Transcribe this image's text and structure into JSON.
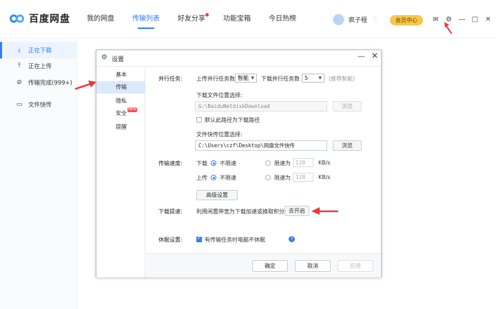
{
  "app": {
    "logo_text": "百度网盘",
    "nav": [
      "我的网盘",
      "传输列表",
      "好友分享",
      "功能宝箱",
      "今日热榜"
    ],
    "active_nav": "传输列表",
    "user": {
      "name": "疯子程"
    },
    "vip_label": "会员中心"
  },
  "sidebar": {
    "items": [
      {
        "label": "正在下载",
        "icon": "download-icon"
      },
      {
        "label": "正在上传",
        "icon": "upload-icon"
      },
      {
        "label": "传输完成(999+)",
        "icon": "check-circle-icon"
      },
      {
        "label": "文件快传",
        "icon": "monitor-icon"
      }
    ],
    "active": "正在下载"
  },
  "dialog": {
    "title": "设置",
    "nav": [
      {
        "label": "基本"
      },
      {
        "label": "传输"
      },
      {
        "label": "隐私"
      },
      {
        "label": "安全",
        "badge": "NEW"
      },
      {
        "label": "提醒"
      }
    ],
    "active_nav": "传输",
    "parallel": {
      "section": "并行任务:",
      "upload_label": "上传并行任务数",
      "upload_value": "智能",
      "download_label": "下载并行任务数",
      "download_value": "5",
      "hint": "(推荐智能)"
    },
    "download_dir": {
      "label": "下载文件位置选择:",
      "path": "G:\\BaiduNetdiskDownload",
      "browse": "浏览",
      "default_checkbox": "默认此路径为下载路径",
      "default_checked": false
    },
    "quick_transfer_dir": {
      "label": "文件快传位置选择:",
      "path": "C:\\Users\\czf\\Desktop\\网盘文件快传",
      "browse": "浏览"
    },
    "speed": {
      "section": "传输速度:",
      "download_label": "下载",
      "upload_label": "上传",
      "unlimited": "不限速",
      "limit_to": "限速为",
      "download_limit": "128",
      "upload_limit": "128",
      "unit": "KB/s",
      "advanced": "高级设置"
    },
    "boost": {
      "section": "下载提速:",
      "text": "利用闲置带宽为下载加速或换取积分",
      "button": "去开启"
    },
    "sleep": {
      "section": "休眠设置:",
      "checkbox": "有传输任务时电脑不休眠",
      "checked": true
    },
    "footer": {
      "ok": "确定",
      "cancel": "取消",
      "apply": "应用"
    }
  },
  "colors": {
    "accent": "#2e7dff",
    "vip": "#f7c64c",
    "arrow": "#e8383d"
  }
}
